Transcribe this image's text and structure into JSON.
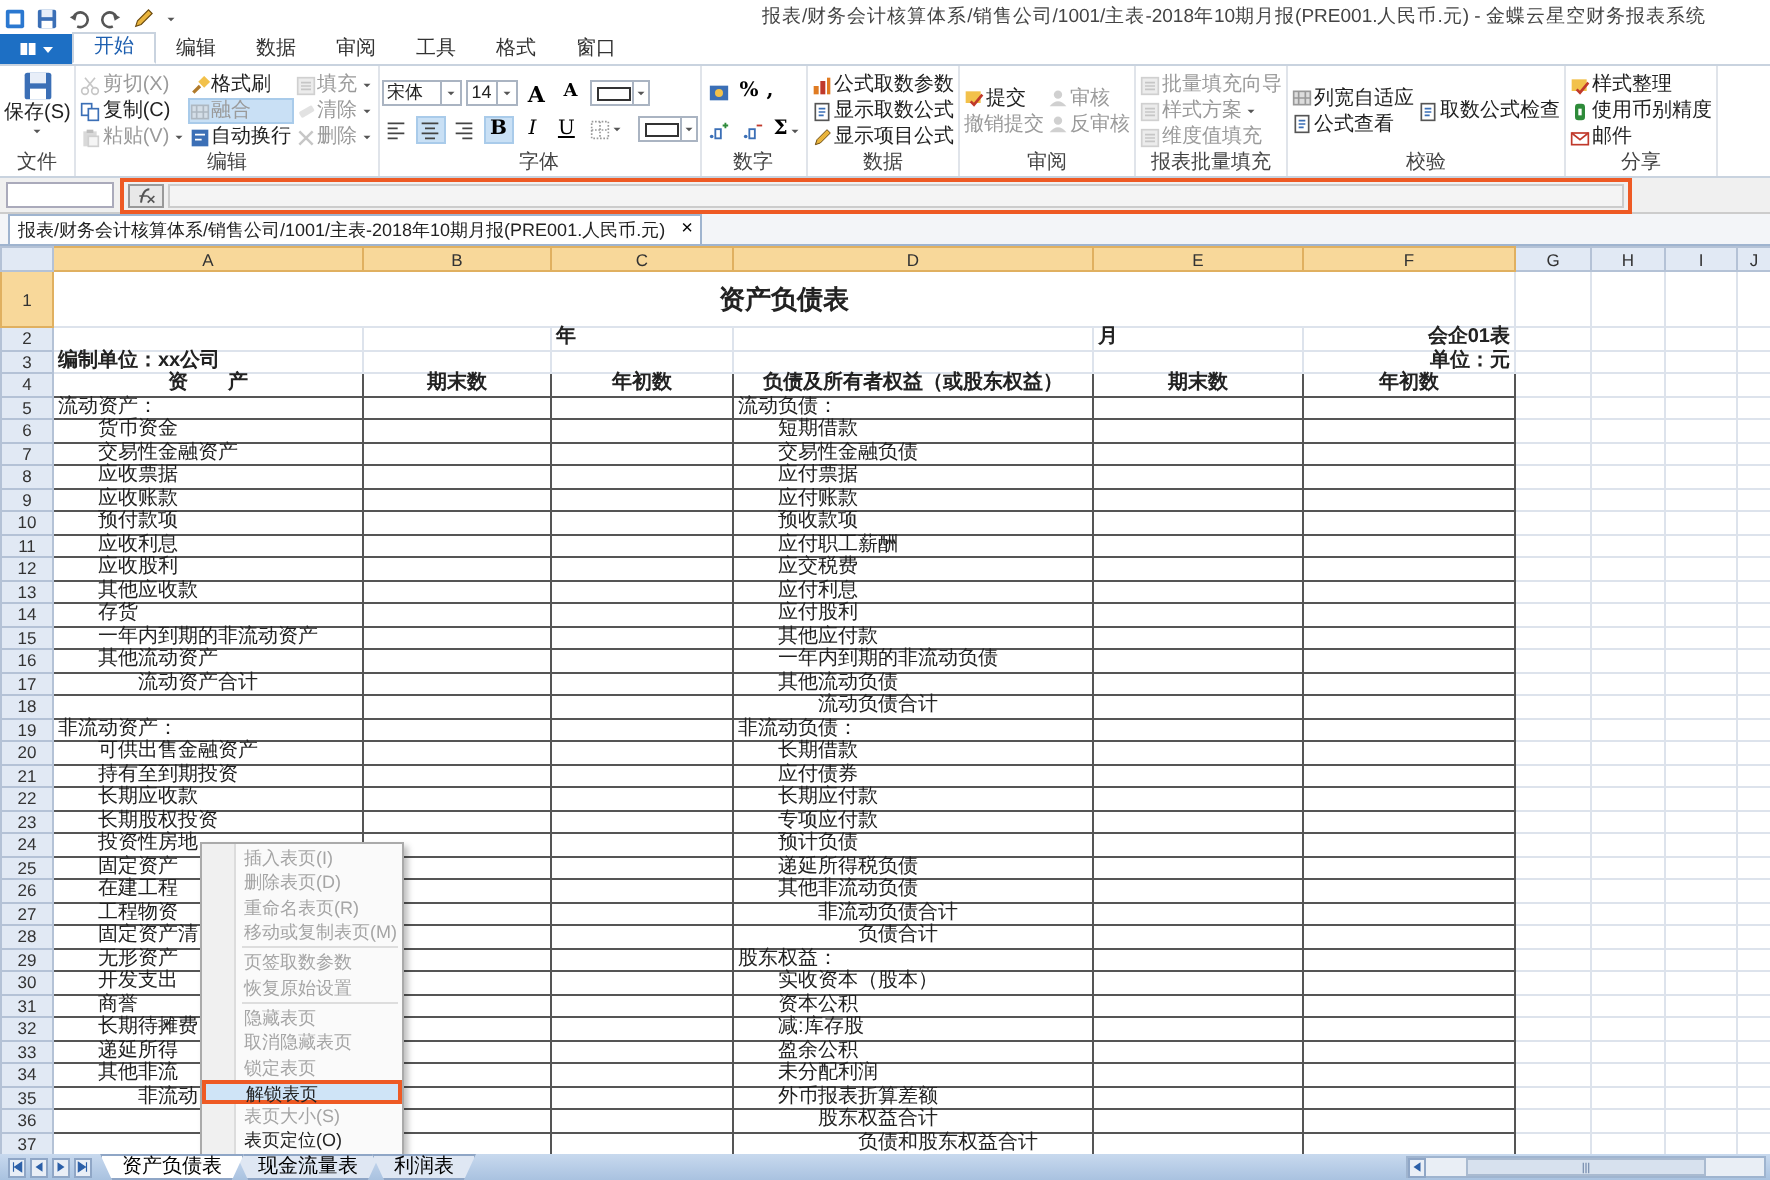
{
  "window": {
    "title": "报表/财务会计核算体系/销售公司/1001/主表-2018年10期月报(PRE001.人民币.元) - 金蝶云星空财务报表系统"
  },
  "menu_tabs": [
    {
      "label": "开始",
      "selected": true
    },
    {
      "label": "编辑",
      "selected": false
    },
    {
      "label": "数据",
      "selected": false
    },
    {
      "label": "审阅",
      "selected": false
    },
    {
      "label": "工具",
      "selected": false
    },
    {
      "label": "格式",
      "selected": false
    },
    {
      "label": "窗口",
      "selected": false
    }
  ],
  "ribbon": [
    {
      "label": "文件",
      "kind": "large",
      "items": [
        {
          "label": "保存(S)",
          "disabled": false,
          "menu": true
        }
      ]
    },
    {
      "label": "编辑",
      "kind": "columns",
      "columns": [
        [
          {
            "label": "剪切(X)",
            "disabled": true,
            "on": false,
            "menu": false
          },
          {
            "label": "复制(C)",
            "disabled": false,
            "on": false,
            "menu": false
          },
          {
            "label": "粘贴(V)",
            "disabled": true,
            "on": false,
            "menu": true
          }
        ],
        [
          {
            "label": "格式刷",
            "disabled": false,
            "on": false,
            "menu": false
          },
          {
            "label": "融合",
            "disabled": true,
            "on": true,
            "menu": false
          },
          {
            "label": "自动换行",
            "disabled": false,
            "on": false,
            "menu": false
          }
        ],
        [
          {
            "label": "填充",
            "disabled": true,
            "on": false,
            "menu": true
          },
          {
            "label": "清除",
            "disabled": true,
            "on": false,
            "menu": true
          },
          {
            "label": "删除",
            "disabled": true,
            "on": false,
            "menu": true
          }
        ]
      ]
    },
    {
      "label": "字体",
      "kind": "font",
      "font_name": "宋体",
      "font_size": "14",
      "size_buttons": [
        {
          "label": "A",
          "kind": "grow"
        },
        {
          "label": "A",
          "kind": "shrink"
        }
      ],
      "format_buttons": [
        {
          "kind": "align-left",
          "on": false
        },
        {
          "kind": "align-center",
          "on": true
        },
        {
          "kind": "align-right",
          "on": false
        },
        {
          "kind": "bold",
          "label": "B",
          "on": true
        },
        {
          "kind": "italic",
          "label": "I",
          "on": false
        },
        {
          "kind": "underline",
          "label": "U",
          "on": false
        },
        {
          "kind": "borders",
          "on": false
        }
      ]
    },
    {
      "label": "数字",
      "kind": "number",
      "rows": [
        [
          {
            "kind": "currency"
          },
          {
            "kind": "text",
            "label": "%",
            "menu": false
          },
          {
            "kind": "text",
            "label": ",",
            "menu": false
          }
        ],
        [
          {
            "kind": "decimal-inc"
          },
          {
            "kind": "decimal-dec"
          },
          {
            "kind": "text",
            "label": "Σ",
            "menu": true
          }
        ]
      ]
    },
    {
      "label": "数据",
      "kind": "columns",
      "columns": [
        [
          {
            "label": "公式取数参数",
            "disabled": false,
            "on": false,
            "menu": false
          },
          {
            "label": "显示取数公式",
            "disabled": false,
            "on": false,
            "menu": false
          },
          {
            "label": "显示项目公式",
            "disabled": false,
            "on": false,
            "menu": false
          }
        ]
      ]
    },
    {
      "label": "审阅",
      "kind": "columns",
      "columns": [
        [
          {
            "label": "提交",
            "disabled": false,
            "on": false,
            "menu": false
          },
          {
            "label": "撤销提交",
            "disabled": true,
            "on": false,
            "menu": false
          }
        ],
        [
          {
            "label": "审核",
            "disabled": true,
            "on": false,
            "menu": false
          },
          {
            "label": "反审核",
            "disabled": true,
            "on": false,
            "menu": false
          }
        ]
      ]
    },
    {
      "label": "报表批量填充",
      "kind": "columns",
      "columns": [
        [
          {
            "label": "批量填充向导",
            "disabled": true,
            "on": false,
            "menu": false
          },
          {
            "label": "样式方案",
            "disabled": true,
            "on": false,
            "menu": true
          },
          {
            "label": "维度值填充",
            "disabled": true,
            "on": false,
            "menu": false
          }
        ]
      ]
    },
    {
      "label": "校验",
      "kind": "columns",
      "columns": [
        [
          {
            "label": "列宽自适应",
            "disabled": false,
            "on": false,
            "menu": false
          },
          {
            "label": "公式查看",
            "disabled": false,
            "on": false,
            "menu": false
          }
        ],
        [
          {
            "label": "取数公式检查",
            "disabled": false,
            "on": false,
            "menu": false
          }
        ]
      ]
    },
    {
      "label": "分享",
      "kind": "columns",
      "columns": [
        [
          {
            "label": "样式整理",
            "disabled": false,
            "on": false,
            "menu": false
          },
          {
            "label": "使用币别精度",
            "disabled": false,
            "on": false,
            "menu": false
          },
          {
            "label": "邮件",
            "disabled": false,
            "on": false,
            "menu": false
          }
        ]
      ]
    }
  ],
  "document_tab": {
    "label": "报表/财务会计核算体系/销售公司/1001/主表-2018年10期月报(PRE001.人民币.元)",
    "close": "×"
  },
  "sheet": {
    "columns": [
      {
        "label": "A",
        "selected": true
      },
      {
        "label": "B",
        "selected": true
      },
      {
        "label": "C",
        "selected": true
      },
      {
        "label": "D",
        "selected": true
      },
      {
        "label": "E",
        "selected": true
      },
      {
        "label": "F",
        "selected": true
      },
      {
        "label": "G",
        "selected": false
      },
      {
        "label": "H",
        "selected": false
      },
      {
        "label": "I",
        "selected": false
      },
      {
        "label": "J",
        "selected": false
      }
    ],
    "title_row": {
      "n": "1",
      "selected": true,
      "text": "资产负债表"
    },
    "row_2": {
      "n": "2",
      "selected": false,
      "year": "年",
      "month": "月",
      "form_no": "会企01表"
    },
    "row_3": {
      "n": "3",
      "selected": false,
      "company": "编制单位：xx公司",
      "unit": "单位：元"
    },
    "header_row": {
      "n": "4",
      "selected": false,
      "cells": [
        "资　　产",
        "期末数",
        "年初数",
        "负债及所有者权益（或股东权益）",
        "期末数",
        "年初数"
      ]
    },
    "rows": [
      {
        "n": "5",
        "selected": false,
        "assets": {
          "text": "流动资产：",
          "kind": "section"
        },
        "liabilities": {
          "text": "流动负债：",
          "kind": "section"
        }
      },
      {
        "n": "6",
        "selected": false,
        "assets": {
          "text": "货币资金",
          "kind": "item"
        },
        "liabilities": {
          "text": "短期借款",
          "kind": "item"
        }
      },
      {
        "n": "7",
        "selected": false,
        "assets": {
          "text": "交易性金融资产",
          "kind": "item"
        },
        "liabilities": {
          "text": "交易性金融负债",
          "kind": "item"
        }
      },
      {
        "n": "8",
        "selected": false,
        "assets": {
          "text": "应收票据",
          "kind": "item"
        },
        "liabilities": {
          "text": "应付票据",
          "kind": "item"
        }
      },
      {
        "n": "9",
        "selected": false,
        "assets": {
          "text": "应收账款",
          "kind": "item"
        },
        "liabilities": {
          "text": "应付账款",
          "kind": "item"
        }
      },
      {
        "n": "10",
        "selected": false,
        "assets": {
          "text": "预付款项",
          "kind": "item"
        },
        "liabilities": {
          "text": "预收款项",
          "kind": "item"
        }
      },
      {
        "n": "11",
        "selected": false,
        "assets": {
          "text": "应收利息",
          "kind": "item"
        },
        "liabilities": {
          "text": "应付职工薪酬",
          "kind": "item"
        }
      },
      {
        "n": "12",
        "selected": false,
        "assets": {
          "text": "应收股利",
          "kind": "item"
        },
        "liabilities": {
          "text": "应交税费",
          "kind": "item"
        }
      },
      {
        "n": "13",
        "selected": false,
        "assets": {
          "text": "其他应收款",
          "kind": "item"
        },
        "liabilities": {
          "text": "应付利息",
          "kind": "item"
        }
      },
      {
        "n": "14",
        "selected": false,
        "assets": {
          "text": "存货",
          "kind": "item"
        },
        "liabilities": {
          "text": "应付股利",
          "kind": "item"
        }
      },
      {
        "n": "15",
        "selected": false,
        "assets": {
          "text": "一年内到期的非流动资产",
          "kind": "item"
        },
        "liabilities": {
          "text": "其他应付款",
          "kind": "item"
        }
      },
      {
        "n": "16",
        "selected": false,
        "assets": {
          "text": "其他流动资产",
          "kind": "item"
        },
        "liabilities": {
          "text": "一年内到期的非流动负债",
          "kind": "item"
        }
      },
      {
        "n": "17",
        "selected": false,
        "assets": {
          "text": "流动资产合计",
          "kind": "subtotal"
        },
        "liabilities": {
          "text": "其他流动负债",
          "kind": "item"
        }
      },
      {
        "n": "18",
        "selected": false,
        "liabilities": {
          "text": "流动负债合计",
          "kind": "subtotal"
        }
      },
      {
        "n": "19",
        "selected": false,
        "assets": {
          "text": "非流动资产：",
          "kind": "section"
        },
        "liabilities": {
          "text": "非流动负债：",
          "kind": "section"
        }
      },
      {
        "n": "20",
        "selected": false,
        "assets": {
          "text": "可供出售金融资产",
          "kind": "item"
        },
        "liabilities": {
          "text": "长期借款",
          "kind": "item"
        }
      },
      {
        "n": "21",
        "selected": false,
        "assets": {
          "text": "持有至到期投资",
          "kind": "item"
        },
        "liabilities": {
          "text": "应付债券",
          "kind": "item"
        }
      },
      {
        "n": "22",
        "selected": false,
        "assets": {
          "text": "长期应收款",
          "kind": "item"
        },
        "liabilities": {
          "text": "长期应付款",
          "kind": "item"
        }
      },
      {
        "n": "23",
        "selected": false,
        "assets": {
          "text": "长期股权投资",
          "kind": "item"
        },
        "liabilities": {
          "text": "专项应付款",
          "kind": "item"
        }
      },
      {
        "n": "24",
        "selected": false,
        "assets": {
          "text": "投资性房地",
          "kind": "item"
        },
        "liabilities": {
          "text": "预计负债",
          "kind": "item"
        }
      },
      {
        "n": "25",
        "selected": false,
        "assets": {
          "text": "固定资产",
          "kind": "item"
        },
        "liabilities": {
          "text": "递延所得税负债",
          "kind": "item"
        }
      },
      {
        "n": "26",
        "selected": false,
        "assets": {
          "text": "在建工程",
          "kind": "item"
        },
        "liabilities": {
          "text": "其他非流动负债",
          "kind": "item"
        }
      },
      {
        "n": "27",
        "selected": false,
        "assets": {
          "text": "工程物资",
          "kind": "item"
        },
        "liabilities": {
          "text": "非流动负债合计",
          "kind": "subtotal"
        }
      },
      {
        "n": "28",
        "selected": false,
        "assets": {
          "text": "固定资产清",
          "kind": "item"
        },
        "liabilities": {
          "text": "负债合计",
          "kind": "total"
        }
      },
      {
        "n": "29",
        "selected": false,
        "assets": {
          "text": "无形资产",
          "kind": "item"
        },
        "liabilities": {
          "text": "股东权益：",
          "kind": "section"
        }
      },
      {
        "n": "30",
        "selected": false,
        "assets": {
          "text": "开发支出",
          "kind": "item"
        },
        "liabilities": {
          "text": "实收资本（股本）",
          "kind": "item"
        }
      },
      {
        "n": "31",
        "selected": false,
        "assets": {
          "text": "商誉",
          "kind": "item"
        },
        "liabilities": {
          "text": "资本公积",
          "kind": "item"
        }
      },
      {
        "n": "32",
        "selected": false,
        "assets": {
          "text": "长期待摊费",
          "kind": "item"
        },
        "liabilities": {
          "text": "减:库存股",
          "kind": "item"
        }
      },
      {
        "n": "33",
        "selected": false,
        "assets": {
          "text": "递延所得",
          "kind": "item"
        },
        "liabilities": {
          "text": "盈余公积",
          "kind": "item"
        }
      },
      {
        "n": "34",
        "selected": false,
        "assets": {
          "text": "其他非流",
          "kind": "item"
        },
        "liabilities": {
          "text": "未分配利润",
          "kind": "item"
        }
      },
      {
        "n": "35",
        "selected": false,
        "assets": {
          "text": "非流动",
          "kind": "subtotal"
        },
        "liabilities": {
          "text": "外币报表折算差额",
          "kind": "item"
        }
      },
      {
        "n": "36",
        "selected": false,
        "liabilities": {
          "text": "股东权益合计",
          "kind": "subtotal"
        }
      },
      {
        "n": "37",
        "selected": false,
        "liabilities": {
          "text": "负债和股东权益合计",
          "kind": "total"
        }
      }
    ]
  },
  "context_menu": {
    "groups": [
      [
        {
          "label": "插入表页(I)",
          "disabled": true,
          "selected": false
        },
        {
          "label": "删除表页(D)",
          "disabled": true,
          "selected": false
        },
        {
          "label": "重命名表页(R)",
          "disabled": true,
          "selected": false
        },
        {
          "label": "移动或复制表页(M)",
          "disabled": true,
          "selected": false
        }
      ],
      [
        {
          "label": "页签取数参数",
          "disabled": true,
          "selected": false
        },
        {
          "label": "恢复原始设置",
          "disabled": true,
          "selected": false
        }
      ],
      [
        {
          "label": "隐藏表页",
          "disabled": true,
          "selected": false
        },
        {
          "label": "取消隐藏表页",
          "disabled": true,
          "selected": false
        },
        {
          "label": "锁定表页",
          "disabled": true,
          "selected": false
        },
        {
          "label": "解锁表页",
          "disabled": false,
          "selected": true
        },
        {
          "label": "表页大小(S)",
          "disabled": true,
          "selected": false
        },
        {
          "label": "表页定位(O)",
          "disabled": false,
          "selected": false
        }
      ]
    ]
  },
  "sheet_tabs": [
    {
      "label": "资产负债表",
      "selected": true
    },
    {
      "label": "现金流量表",
      "selected": false
    },
    {
      "label": "利润表",
      "selected": false
    }
  ]
}
